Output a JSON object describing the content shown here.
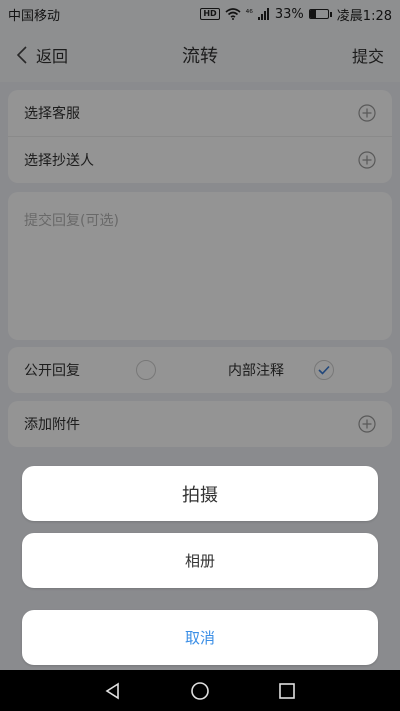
{
  "status_bar": {
    "carrier": "中国移动",
    "signal_text": "⁴⁶",
    "battery_text": "33%",
    "battery_level": 0.33,
    "time": "凌晨1:28"
  },
  "nav": {
    "back_label": "返回",
    "title": "流转",
    "submit_label": "提交"
  },
  "form": {
    "select_service_label": "选择客服",
    "select_cc_label": "选择抄送人",
    "reply_placeholder": "提交回复(可选)",
    "public_reply_label": "公开回复",
    "internal_note_label": "内部注释",
    "add_attachment_label": "添加附件"
  },
  "action_sheet": {
    "take_photo_label": "拍摄",
    "album_label": "相册",
    "cancel_label": "取消"
  },
  "colors": {
    "accent": "#3a8ee6",
    "check": "#3a7bd5"
  }
}
